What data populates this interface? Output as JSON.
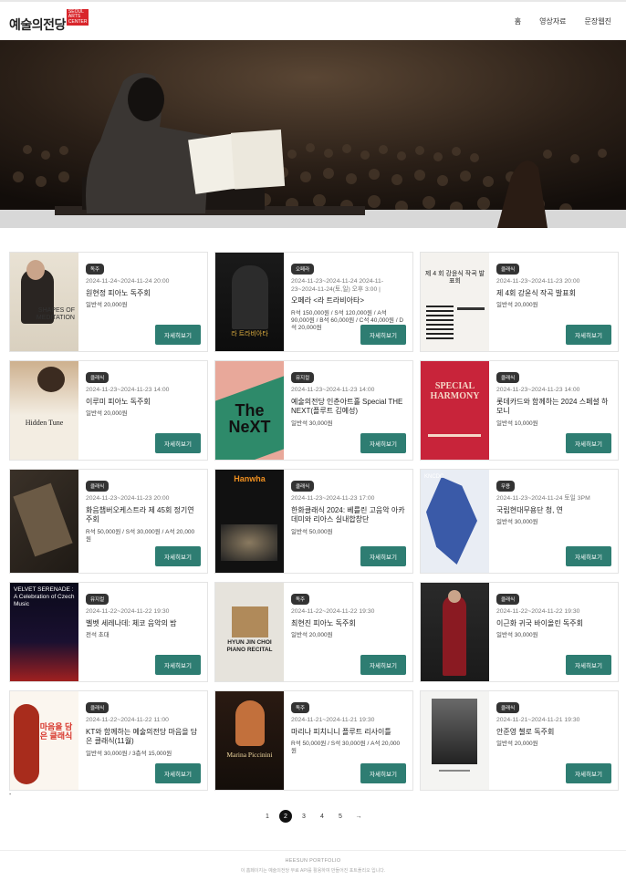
{
  "header": {
    "logo_text": "예술의전당",
    "logo_sub": "SEOUL ARTS CENTER",
    "nav": [
      "홈",
      "영상자료",
      "문장웹진"
    ]
  },
  "cards": [
    {
      "badge": "독주",
      "date": "2024-11-24~2024-11-24 20:00",
      "title": "원현정 피아노 독주회",
      "price": "일반석 20,000원",
      "button": "자세히보기",
      "poster_text": "SHAPES OF MEDITATION"
    },
    {
      "badge": "오페라",
      "date": "2024-11-23~2024-11-24 2024-11-23~2024-11-24(토,일) 오후 3:00 |",
      "title": "오페라 <라 트라비아타>",
      "price": "R석 150,000원 / S석 120,000원 / A석 90,000원 / B석 60,000원 / C석 40,000원 / D석 20,000원",
      "button": "자세히보기",
      "poster_text": "라 트라비아타"
    },
    {
      "badge": "클래식",
      "date": "2024-11-23~2024-11-23 20:00",
      "title": "제 4회 강윤식 작곡 발표회",
      "price": "일반석 20,000원",
      "button": "자세히보기",
      "poster_text": "제 4 회 강윤식 작곡 발표회"
    },
    {
      "badge": "클래식",
      "date": "2024-11-23~2024-11-23 14:00",
      "title": "이루미 피아노 독주회",
      "price": "일반석 20,000원",
      "button": "자세히보기",
      "poster_text": "Hidden Tune"
    },
    {
      "badge": "뮤지컬",
      "date": "2024-11-23~2024-11-23 14:00",
      "title": "예술의전당 인춘아트홀 Special THE NEXT(플루트 김예성)",
      "price": "일반석 30,000원",
      "button": "자세히보기",
      "poster_text": "The NeXT"
    },
    {
      "badge": "클래식",
      "date": "2024-11-23~2024-11-23 14:00",
      "title": "롯데카드와 함께하는 2024 스페셜 하모니",
      "price": "일반석 10,000원",
      "button": "자세히보기",
      "poster_text": "SPECIAL HARMONY"
    },
    {
      "badge": "클래식",
      "date": "2024-11-23~2024-11-23 20:00",
      "title": "화음챔버오케스트라 제 45회 정기연주회",
      "price": "R석 50,000원 / S석 30,000원 / A석 20,000원",
      "button": "자세히보기",
      "poster_text": ""
    },
    {
      "badge": "클래식",
      "date": "2024-11-23~2024-11-23 17:00",
      "title": "한화클래식 2024: 베를린 고음악 아카데미와 리아스 실내합창단",
      "price": "일반석 50,000원",
      "button": "자세히보기",
      "poster_text": "Hanwha"
    },
    {
      "badge": "무용",
      "date": "2024-11-23~2024-11-24 토일 3PM",
      "title": "국립현대무용단 청, 연",
      "price": "일반석 30,000원",
      "button": "자세히보기",
      "poster_text": "KNCDC"
    },
    {
      "badge": "뮤지컬",
      "date": "2024-11-22~2024-11-22 19:30",
      "title": "벨벳 세레나데: 체코 음악의 밤",
      "price": "전석 초대",
      "button": "자세히보기",
      "poster_text": "VELVET SERENADE : A Celebration of Czech Music"
    },
    {
      "badge": "독주",
      "date": "2024-11-22~2024-11-22 19:30",
      "title": "최현진 피아노 독주회",
      "price": "일반석 20,000원",
      "button": "자세히보기",
      "poster_text": "HYUN JIN CHOI PIANO RECITAL"
    },
    {
      "badge": "클래식",
      "date": "2024-11-22~2024-11-22 19:30",
      "title": "이근화 귀국 바이올린 독주회",
      "price": "일반석 30,000원",
      "button": "자세히보기",
      "poster_text": ""
    },
    {
      "badge": "클래식",
      "date": "2024-11-22~2024-11-22 11:00",
      "title": "KT와 함께하는 예술의전당 마음을 담은 클래식(11월)",
      "price": "일반석 30,000원 / 3층석 15,000원",
      "button": "자세히보기",
      "poster_text": "마음을 담은 클래식"
    },
    {
      "badge": "독주",
      "date": "2024-11-21~2024-11-21 19:30",
      "title": "마리나 피치니니 플루트 리사이틀",
      "price": "R석 50,000원 / S석 30,000원 / A석 20,000원",
      "button": "자세히보기",
      "poster_text": "Marina Piccinini"
    },
    {
      "badge": "클래식",
      "date": "2024-11-21~2024-11-21 19:30",
      "title": "안준영 첼로 독주회",
      "price": "일반석 20,000원",
      "button": "자세히보기",
      "poster_text": ""
    }
  ],
  "pagination": [
    "1",
    "2",
    "3",
    "4",
    "5",
    "→"
  ],
  "pagination_active": "2",
  "footer": {
    "name": "HEESUN PORTFOLIO",
    "desc": "이 홈페이지는 예술의전당 무료 API를 활용하여 만들어진 포트폴리오 입니다."
  },
  "colors": {
    "button": "#2e7d72",
    "badge": "#333333",
    "logo_red": "#d9252b"
  }
}
